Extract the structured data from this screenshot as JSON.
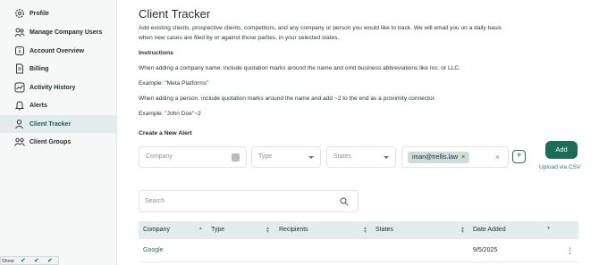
{
  "sidebar": {
    "items": [
      {
        "label": "Profile",
        "icon": "gear-icon"
      },
      {
        "label": "Manage Company Users",
        "icon": "users-icon"
      },
      {
        "label": "Account Overview",
        "icon": "info-icon"
      },
      {
        "label": "Billing",
        "icon": "document-icon"
      },
      {
        "label": "Activity History",
        "icon": "chart-icon"
      },
      {
        "label": "Alerts",
        "icon": "bell-icon"
      },
      {
        "label": "Client Tracker",
        "icon": "person-icon",
        "active": true
      },
      {
        "label": "Client Groups",
        "icon": "group-icon"
      }
    ]
  },
  "main": {
    "title": "Client Tracker",
    "intro_line1": "Add existing clients, prospective clients, competitors, and any company or person you would like to track. We will email you on a daily basis",
    "intro_line2": "when new cases are filed by or against those parties, in your selected states.",
    "instructions_heading": "Instructions",
    "instr1": "When adding a company name, include quotation marks around the name and omit business abbreviations like Inc. or LLC.",
    "example1": "Example: \"Meta Platforms\"",
    "instr2": "When adding a person, include quotation marks around the name and add ~2 to the end as a proximity connector.",
    "example2": "Example: \"John Doe\"~2",
    "create_heading": "Create a New Alert"
  },
  "form": {
    "company_placeholder": "Company",
    "type_placeholder": "Type",
    "states_placeholder": "States",
    "recipient_chip": "iman@trellis.law",
    "chip_remove": "×",
    "clear": "×",
    "plus": "+",
    "add_label": "Add",
    "upload_label": "Upload via CSV"
  },
  "search": {
    "placeholder": "Search"
  },
  "table": {
    "headers": [
      "Company",
      "Type",
      "Recipients",
      "States",
      "Date Added"
    ],
    "rows": [
      {
        "company": "Google",
        "type": "",
        "recipients": "",
        "states": "",
        "date_added": "9/5/2025"
      }
    ]
  },
  "toast": {
    "text": "Show"
  },
  "colors": {
    "accent": "#1e6b58",
    "header_bg": "#e2ecec",
    "sidebar_bg": "#f6f7f7"
  }
}
